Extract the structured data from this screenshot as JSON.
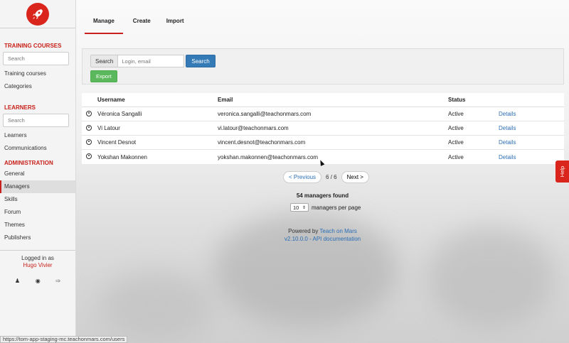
{
  "sidebar": {
    "training_title": "TRAINING COURSES",
    "training_search_placeholder": "Search",
    "training_items": [
      "Training courses",
      "Categories"
    ],
    "learners_title": "LEARNERS",
    "learners_search_placeholder": "Search",
    "learners_items": [
      "Learners",
      "Communications"
    ],
    "admin_title": "ADMINISTRATION",
    "admin_items": [
      "General",
      "Managers",
      "Skills",
      "Forum",
      "Themes",
      "Publishers"
    ],
    "active_item": "Managers",
    "logged_in_label": "Logged in as",
    "user_name": "Hugo Vivier"
  },
  "tabs": [
    "Manage",
    "Create",
    "Import"
  ],
  "active_tab": "Manage",
  "search": {
    "label": "Search",
    "placeholder": "Login, email",
    "button": "Search",
    "export_button": "Export"
  },
  "table": {
    "headers": {
      "username": "Username",
      "email": "Email",
      "status": "Status"
    },
    "rows": [
      {
        "username": "Véronica Sangalli",
        "email": "veronica.sangalli@teachonmars.com",
        "status": "Active",
        "action": "Details"
      },
      {
        "username": "Vi Latour",
        "email": "vi.latour@teachonmars.com",
        "status": "Active",
        "action": "Details"
      },
      {
        "username": "Vincent Desnot",
        "email": "vincent.desnot@teachonmars.com",
        "status": "Active",
        "action": "Details"
      },
      {
        "username": "Yokshan Makonnen",
        "email": "yokshan.makonnen@teachonmars.com",
        "status": "Active",
        "action": "Details"
      }
    ]
  },
  "pagination": {
    "prev": "< Previous",
    "info": "6 / 6",
    "next": "Next >"
  },
  "summary": {
    "found": "54 managers found",
    "per_page_value": "10",
    "per_page_label": "managers per page"
  },
  "footer": {
    "powered_by": "Powered by",
    "brand_link": "Teach on Mars",
    "version_line": "v2.10.0.0 - API documentation"
  },
  "help_label": "Help",
  "status_url": "https://tom-app-staging-mc.teachonmars.com/users",
  "colors": {
    "accent": "#c8201a",
    "primary": "#337ab7",
    "success": "#5cb85c",
    "link": "#2a6db5"
  }
}
